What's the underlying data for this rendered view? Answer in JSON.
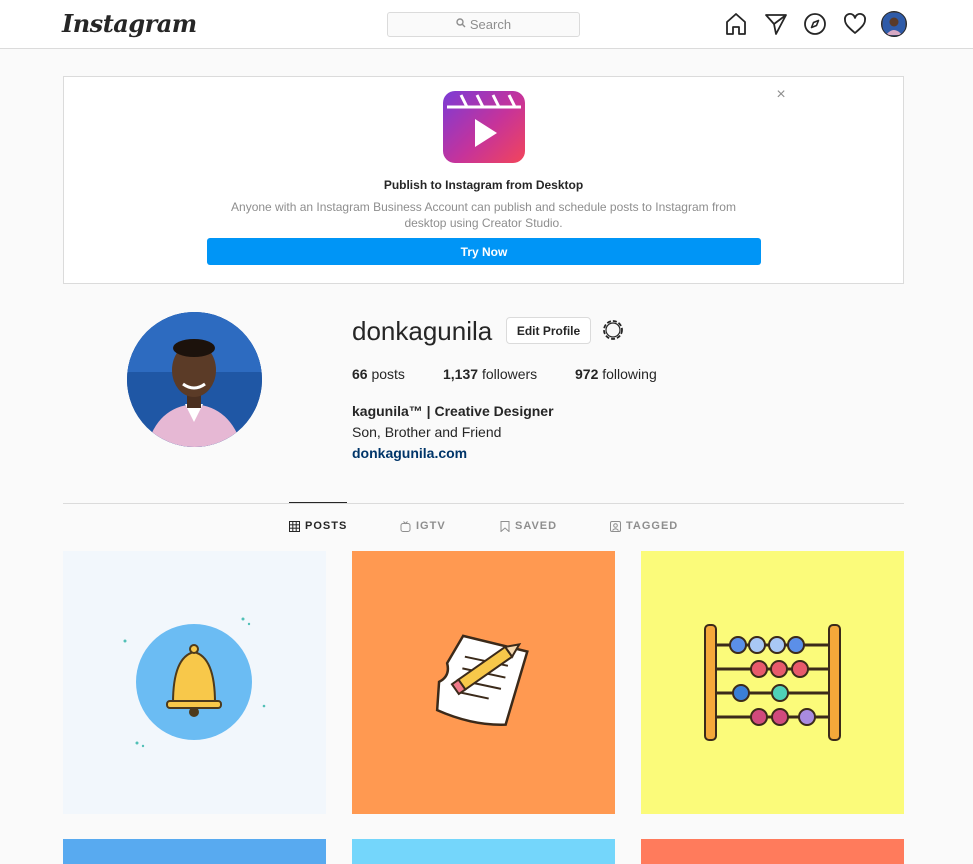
{
  "nav": {
    "logo": "Instagram",
    "search_placeholder": "Search",
    "icons": [
      "home-icon",
      "direct-icon",
      "explore-icon",
      "activity-heart-icon",
      "profile-avatar"
    ]
  },
  "banner": {
    "title": "Publish to Instagram from Desktop",
    "description": "Anyone with an Instagram Business Account can publish and schedule posts to Instagram from desktop using Creator Studio.",
    "button_label": "Try Now",
    "close_label": "×"
  },
  "profile": {
    "username": "donkagunila",
    "edit_button": "Edit Profile",
    "stats": {
      "posts_count": "66",
      "posts_label": "posts",
      "followers_count": "1,137",
      "followers_label": "followers",
      "following_count": "972",
      "following_label": "following"
    },
    "bio_name": "kagunila™ | Creative Designer",
    "bio_line": "Son, Brother and Friend",
    "website": "donkagunila.com"
  },
  "tabs": [
    {
      "label": "POSTS",
      "icon": "grid-icon",
      "active": true
    },
    {
      "label": "IGTV",
      "icon": "igtv-icon",
      "active": false
    },
    {
      "label": "SAVED",
      "icon": "bookmark-icon",
      "active": false
    },
    {
      "label": "TAGGED",
      "icon": "tagged-icon",
      "active": false
    }
  ],
  "posts": [
    {
      "subject": "bell",
      "bg": "#f2f7fc"
    },
    {
      "subject": "paper and pencil",
      "bg": "#ff9951"
    },
    {
      "subject": "abacus",
      "bg": "#fbfb7a"
    },
    {
      "subject": "",
      "bg": "#58aaf0"
    },
    {
      "subject": "",
      "bg": "#74d6fb"
    },
    {
      "subject": "",
      "bg": "#ff7b5c"
    }
  ],
  "colors": {
    "accent": "#0095f6",
    "link": "#003569",
    "border": "#dbdbdb",
    "muted": "#8e8e8e"
  }
}
